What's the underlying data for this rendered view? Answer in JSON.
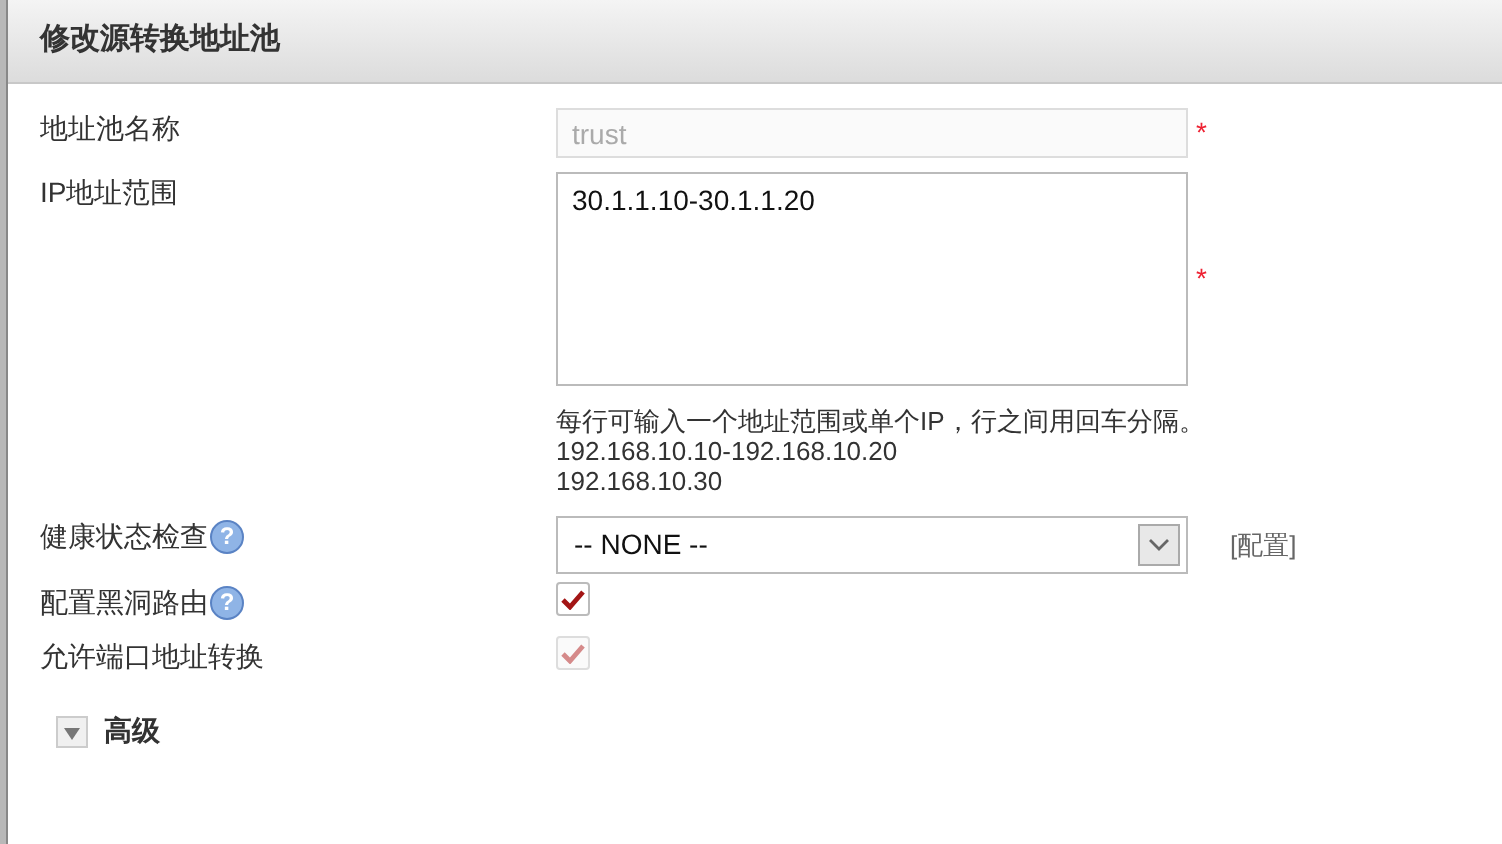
{
  "panel": {
    "title": "修改源转换地址池"
  },
  "fields": [
    {
      "kind": "text",
      "label": "地址池名称",
      "value": "trust",
      "disabled": true,
      "required_mark": "*"
    },
    {
      "kind": "textarea",
      "label": "IP地址范围",
      "value": "30.1.1.10-30.1.1.20",
      "required_mark": "*",
      "hint": [
        "每行可输入一个地址范围或单个IP，行之间用回车分隔。",
        "192.168.10.10-192.168.10.20",
        "192.168.10.30"
      ]
    },
    {
      "kind": "select",
      "label": "健康状态检查",
      "help_icon": "?",
      "value": "-- NONE --",
      "link": "[配置]"
    },
    {
      "kind": "checkbox",
      "label": "配置黑洞路由",
      "help_icon": "?",
      "checked": true,
      "disabled": false
    },
    {
      "kind": "checkbox",
      "label": "允许端口地址转换",
      "checked": true,
      "disabled": true
    }
  ],
  "advanced": {
    "label": "高级",
    "expanded": false
  }
}
